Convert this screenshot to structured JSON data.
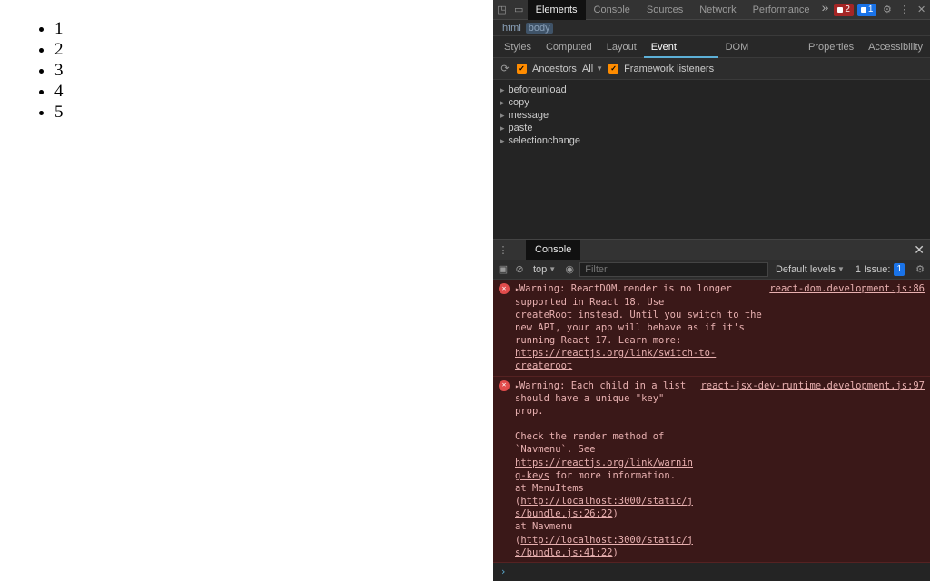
{
  "page": {
    "list_items": [
      "1",
      "2",
      "3",
      "4",
      "5"
    ]
  },
  "topbar": {
    "tabs": [
      "Elements",
      "Console",
      "Sources",
      "Network",
      "Performance"
    ],
    "active_tab_index": 0,
    "error_count": "2",
    "issue_count": "1"
  },
  "breadcrumb": [
    "html",
    "body"
  ],
  "subtabs": {
    "items": [
      "Styles",
      "Computed",
      "Layout",
      "Event Listeners",
      "DOM Breakpoints",
      "Properties",
      "Accessibility"
    ],
    "active_index": 3
  },
  "el_toolbar": {
    "ancestors_label": "Ancestors",
    "scope": "All",
    "framework_label": "Framework listeners"
  },
  "events": [
    "beforeunload",
    "copy",
    "message",
    "paste",
    "selectionchange"
  ],
  "console": {
    "tab_label": "Console",
    "top_label": "top",
    "filter_placeholder": "Filter",
    "levels_label": "Default levels",
    "issues_label": "1 Issue:",
    "issues_count": "1",
    "errors": [
      {
        "head": "Warning: ReactDOM.render is no longer supported in React 18. Use ",
        "body": "createRoot instead. Until you switch to the new API, your app will behave as if it's running React 17. Learn more: ",
        "learn_link": "https://reactjs.org/link/switch-to-createroot",
        "src": "react-dom.development.js:86"
      },
      {
        "head": "Warning: Each child in a list should have a unique \"key\" prop.",
        "body1": "Check the render method of `Navmenu`. See ",
        "keys_link": "https://reactjs.org/link/warning-keys",
        "body2": " for more information.",
        "stack1_pre": "    at MenuItems (",
        "stack1_link": "http://localhost:3000/static/js/bundle.js:26:22",
        "stack1_post": ")",
        "stack2_pre": "    at Navmenu (",
        "stack2_link": "http://localhost:3000/static/js/bundle.js:41:22",
        "stack2_post": ")",
        "src": "react-jsx-dev-runtime.development.js:97"
      }
    ]
  }
}
